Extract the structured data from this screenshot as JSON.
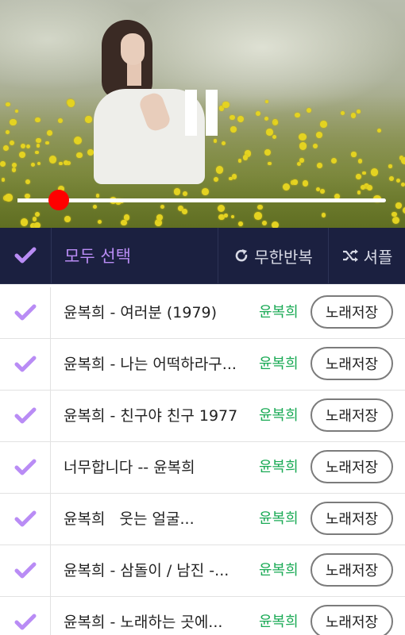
{
  "player": {
    "progress": 0.113,
    "state": "playing",
    "pause_icon": "pause-icon"
  },
  "toolbar": {
    "select_all_label": "모두 선택",
    "repeat_label": "무한반복",
    "shuffle_label": "셔플",
    "check_icon": "check-icon",
    "repeat_icon": "repeat-icon",
    "shuffle_icon": "shuffle-icon"
  },
  "colors": {
    "accent_purple": "#b98cf5",
    "artist_green": "#1aaa55",
    "toolbar_bg": "#1b2040",
    "seek_thumb": "#ff0000"
  },
  "songs": [
    {
      "title": "윤복희 - 여러분 (1979)",
      "artist": "윤복희",
      "save_label": "노래저장",
      "checked": true
    },
    {
      "title": "윤복희 - 나는 어떡하라구...",
      "artist": "윤복희",
      "save_label": "노래저장",
      "checked": true
    },
    {
      "title": "윤복희 - 친구야 친구 1977",
      "artist": "윤복희",
      "save_label": "노래저장",
      "checked": true
    },
    {
      "title": "너무합니다 -- 윤복희",
      "artist": "윤복희",
      "save_label": "노래저장",
      "checked": true
    },
    {
      "title": "윤복희   웃는 얼굴...",
      "artist": "윤복희",
      "save_label": "노래저장",
      "checked": true
    },
    {
      "title": "윤복희 - 삼돌이 / 남진 -...",
      "artist": "윤복희",
      "save_label": "노래저장",
      "checked": true
    },
    {
      "title": "윤복희 - 노래하는 곳에...",
      "artist": "윤복희",
      "save_label": "노래저장",
      "checked": true
    }
  ]
}
